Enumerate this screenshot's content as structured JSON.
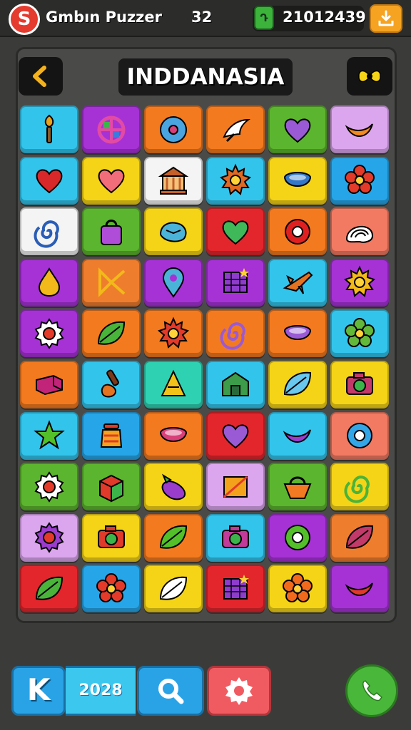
{
  "header": {
    "logo_letter": "S",
    "app_name": "Gmbın Puzzer",
    "level": "32",
    "gem_glyph": "Դ",
    "coins": "21012439",
    "shop_icon": "download-tray-icon"
  },
  "board": {
    "title": "INDDANASIA",
    "back_icon": "chevron-left-icon",
    "hint_icon": "bow-icon"
  },
  "palette": {
    "c": "#33c4ec",
    "p": "#a632d6",
    "o": "#f47a1f",
    "g": "#5cb52e",
    "l": "#dca6ee",
    "y": "#f5d417",
    "w": "#f4f4f4",
    "r": "#e3262c",
    "t": "#2fd1b3",
    "s": "#f27a62",
    "b": "#26a6e8",
    "k": "#ef7d2e"
  },
  "tiles": [
    {
      "bg": "c",
      "icon": "torch-icon",
      "color": "#e8a21b"
    },
    {
      "bg": "p",
      "icon": "circle-cross-icon",
      "color": "#e24ba4"
    },
    {
      "bg": "o",
      "icon": "disc-icon",
      "color": "#4aa4e0"
    },
    {
      "bg": "o",
      "icon": "wing-icon",
      "color": "#ffffff"
    },
    {
      "bg": "g",
      "icon": "heart-icon",
      "color": "#9a5ad6"
    },
    {
      "bg": "l",
      "icon": "crescent-icon",
      "color": "#f28a22"
    },
    {
      "bg": "c",
      "icon": "heart-icon",
      "color": "#d8282a"
    },
    {
      "bg": "y",
      "icon": "heart-icon",
      "color": "#f26d7a"
    },
    {
      "bg": "w",
      "icon": "temple-icon",
      "color": "#c5602a"
    },
    {
      "bg": "c",
      "icon": "sun-icon",
      "color": "#e06a24"
    },
    {
      "bg": "y",
      "icon": "bowl-icon",
      "color": "#3478c8"
    },
    {
      "bg": "b",
      "icon": "flower-icon",
      "color": "#e33a2a"
    },
    {
      "bg": "w",
      "icon": "swirl-icon",
      "color": "#2a5db5"
    },
    {
      "bg": "g",
      "icon": "bag-icon",
      "color": "#b04dd8"
    },
    {
      "bg": "y",
      "icon": "stone-icon",
      "color": "#4bb3d8"
    },
    {
      "bg": "r",
      "icon": "heart-icon",
      "color": "#3fb85a"
    },
    {
      "bg": "o",
      "icon": "ring-icon",
      "color": "#e02020"
    },
    {
      "bg": "s",
      "icon": "shell-icon",
      "color": "#ffffff"
    },
    {
      "bg": "p",
      "icon": "drop-icon",
      "color": "#f2b91b"
    },
    {
      "bg": "k",
      "icon": "bow-icon",
      "color": "#f2b91b"
    },
    {
      "bg": "p",
      "icon": "pin-icon",
      "color": "#4bb3d8"
    },
    {
      "bg": "p",
      "icon": "map-icon",
      "color": "#8e3ccc"
    },
    {
      "bg": "c",
      "icon": "plane-icon",
      "color": "#e37320"
    },
    {
      "bg": "p",
      "icon": "sun-icon",
      "color": "#f2b91b"
    },
    {
      "bg": "p",
      "icon": "gear-icon",
      "color": "#ffffff"
    },
    {
      "bg": "o",
      "icon": "leaf-icon",
      "color": "#4ab33a"
    },
    {
      "bg": "o",
      "icon": "sun-icon",
      "color": "#e33a2a"
    },
    {
      "bg": "o",
      "icon": "swirl-icon",
      "color": "#9a5ad6"
    },
    {
      "bg": "o",
      "icon": "bowl-icon",
      "color": "#9a5ad6"
    },
    {
      "bg": "c",
      "icon": "flower-icon",
      "color": "#63b83a"
    },
    {
      "bg": "o",
      "icon": "block-icon",
      "color": "#c2247a"
    },
    {
      "bg": "c",
      "icon": "brush-icon",
      "color": "#e37320"
    },
    {
      "bg": "t",
      "icon": "pyramid-icon",
      "color": "#f2c21b"
    },
    {
      "bg": "c",
      "icon": "house-icon",
      "color": "#3c9c4a"
    },
    {
      "bg": "y",
      "icon": "leaf-icon",
      "color": "#6ac7ee"
    },
    {
      "bg": "y",
      "icon": "camera-icon",
      "color": "#c23a6a"
    },
    {
      "bg": "c",
      "icon": "star-icon",
      "color": "#53c02a"
    },
    {
      "bg": "b",
      "icon": "jar-icon",
      "color": "#f2a21b"
    },
    {
      "bg": "o",
      "icon": "bowl-icon",
      "color": "#d8407a"
    },
    {
      "bg": "r",
      "icon": "heart-icon",
      "color": "#9a5ad6"
    },
    {
      "bg": "c",
      "icon": "crescent-icon",
      "color": "#9a3ccc"
    },
    {
      "bg": "s",
      "icon": "ring-icon",
      "color": "#33a6e8"
    },
    {
      "bg": "g",
      "icon": "gear-icon",
      "color": "#ffffff"
    },
    {
      "bg": "g",
      "icon": "box-icon",
      "color": "#e03a2a"
    },
    {
      "bg": "y",
      "icon": "eggplant-icon",
      "color": "#9a3ccc"
    },
    {
      "bg": "l",
      "icon": "flag-icon",
      "color": "#f2a21b"
    },
    {
      "bg": "g",
      "icon": "basket-icon",
      "color": "#f27a22"
    },
    {
      "bg": "y",
      "icon": "swirl-icon",
      "color": "#4ab33a"
    },
    {
      "bg": "l",
      "icon": "gear-icon",
      "color": "#9a3ccc"
    },
    {
      "bg": "y",
      "icon": "camera-icon",
      "color": "#e03a2a"
    },
    {
      "bg": "o",
      "icon": "leaf-icon",
      "color": "#53c02a"
    },
    {
      "bg": "c",
      "icon": "camera-icon",
      "color": "#c23a9a"
    },
    {
      "bg": "p",
      "icon": "ring-icon",
      "color": "#53c02a"
    },
    {
      "bg": "k",
      "icon": "leaf-icon",
      "color": "#c23a6a"
    },
    {
      "bg": "r",
      "icon": "leaf-icon",
      "color": "#4ab33a"
    },
    {
      "bg": "b",
      "icon": "flower-icon",
      "color": "#e33a2a"
    },
    {
      "bg": "y",
      "icon": "leaf-icon",
      "color": "#ffffff"
    },
    {
      "bg": "r",
      "icon": "map-icon",
      "color": "#8e3ccc"
    },
    {
      "bg": "y",
      "icon": "flower-icon",
      "color": "#f26a1b"
    },
    {
      "bg": "p",
      "icon": "crescent-icon",
      "color": "#e03a2a"
    }
  ],
  "bottom": {
    "k_label": "K",
    "score": "2028",
    "search_icon": "search-icon",
    "settings_icon": "gear-icon",
    "call_icon": "phone-icon"
  }
}
